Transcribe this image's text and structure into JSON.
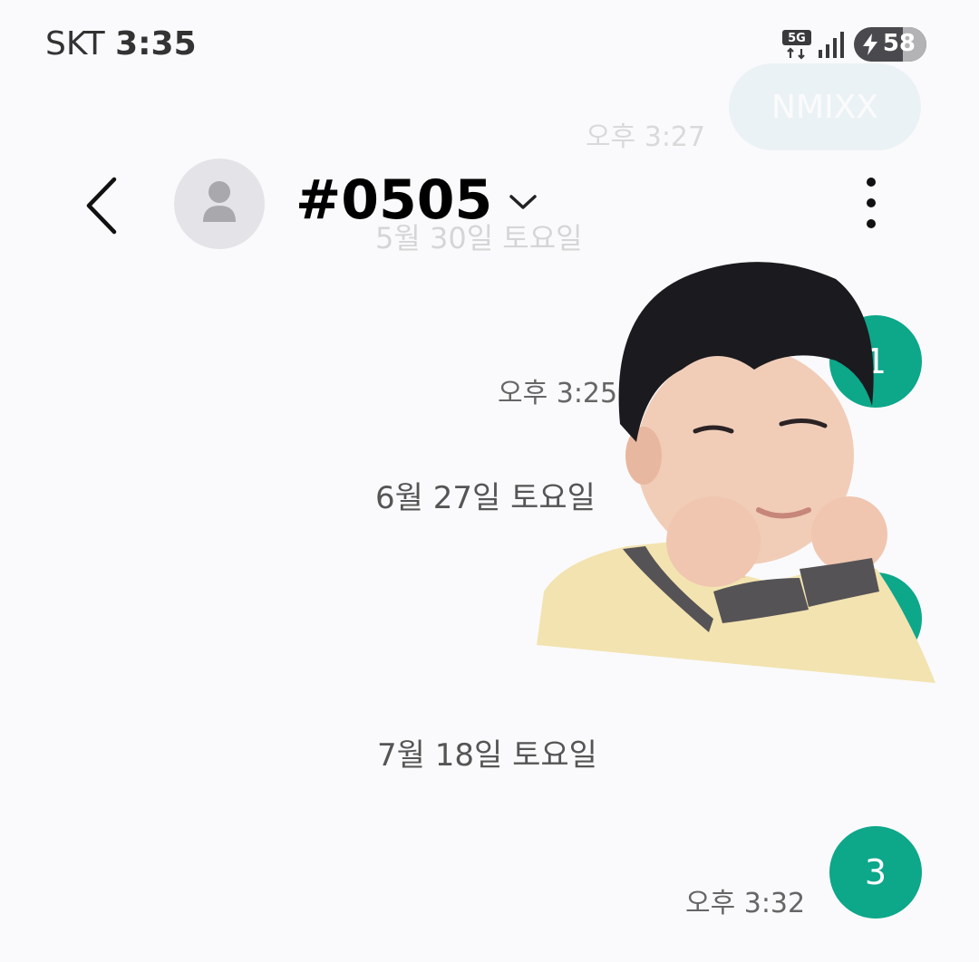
{
  "status_bar": {
    "carrier": "SKT",
    "time": "3:35",
    "network": "5G",
    "battery": "58"
  },
  "header": {
    "title": "#0505"
  },
  "messages": {
    "faded_top": {
      "bubble_text": "NMIXX",
      "time": "오후 3:27",
      "date_divider": "5월 30일 토요일"
    },
    "bubble1": {
      "text": "1"
    },
    "time1": "오후 3:25",
    "date2": "6월 27일 토요일",
    "bubble2": {
      "text": ""
    },
    "date3": "7월 18일 토요일",
    "bubble3": {
      "text": "3"
    },
    "time3": "오후 3:32"
  },
  "sticker": {
    "icon": "person-sticker",
    "colors": {
      "hair": "#1b1a1e",
      "sweater": "#f2e3b0",
      "collar": "#555356"
    }
  },
  "colors": {
    "accent": "#0da78a",
    "background": "#fafafc"
  }
}
